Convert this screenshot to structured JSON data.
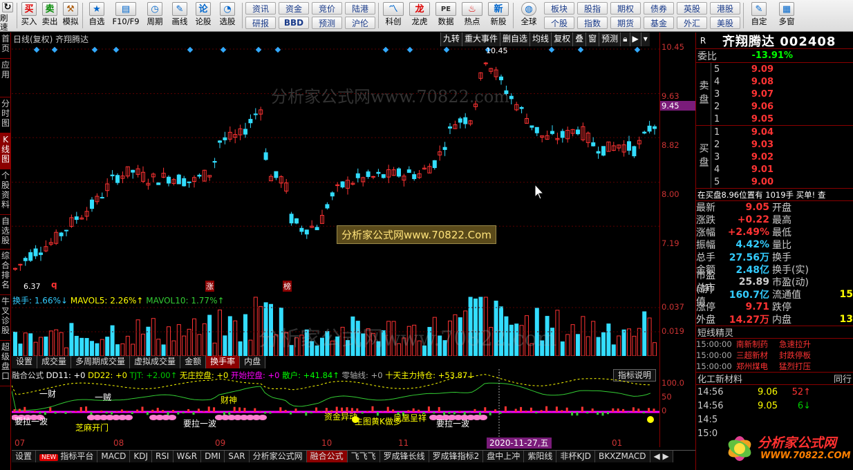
{
  "toolbar": {
    "buttons": [
      {
        "label": "刷速",
        "icon": "refresh-icon"
      },
      {
        "label": "买入",
        "icon": "买"
      },
      {
        "label": "卖出",
        "icon": "卖"
      },
      {
        "label": "模拟",
        "icon": "hammer-icon"
      },
      {
        "label": "自选",
        "icon": "star-icon"
      },
      {
        "label": "F10/F9",
        "icon": "f10-icon"
      },
      {
        "label": "周期",
        "icon": "clock-icon"
      },
      {
        "label": "画线",
        "icon": "pencil-icon"
      },
      {
        "label": "论股",
        "icon": "论"
      },
      {
        "label": "选股",
        "icon": "chart-icon"
      }
    ],
    "pairs": [
      [
        "资讯",
        "研报"
      ],
      [
        "资金",
        "BBD"
      ],
      [
        "竞价",
        "预测"
      ],
      [
        "陆港",
        "沪伦"
      ]
    ],
    "buttons2": [
      {
        "label": "科创",
        "icon": "科"
      },
      {
        "label": "龙虎",
        "icon": "dragon-icon"
      },
      {
        "label": "数据",
        "icon": "PE"
      },
      {
        "label": "热点",
        "icon": "hot-icon"
      },
      {
        "label": "新股",
        "icon": "new-icon"
      },
      {
        "label": "全球",
        "icon": "globe-icon"
      }
    ],
    "pairs2": [
      [
        "板块",
        "个股"
      ],
      [
        "股指",
        "指数"
      ],
      [
        "期权",
        "期货"
      ],
      [
        "债券",
        "基金"
      ],
      [
        "英股",
        "外汇"
      ],
      [
        "港股",
        "美股"
      ]
    ],
    "buttons3": [
      {
        "label": "自定",
        "icon": "custom-icon"
      },
      {
        "label": "多窗",
        "icon": "window-icon"
      }
    ]
  },
  "leftnav": [
    "首页",
    "应用",
    "分时图",
    "K线图",
    "个股资料",
    "自选股",
    "综合排名",
    "牛叉诊股",
    "超级盘口"
  ],
  "chart": {
    "title": "日线(复权) 齐翔腾达",
    "tabs": [
      "九转",
      "重大事件",
      "删自选",
      "均线",
      "复权",
      "叠",
      "窗",
      "预测"
    ],
    "price_labels": [
      "10.45",
      "9.63",
      "8.82",
      "8.00",
      "7.19"
    ],
    "current_price_tag": "9.45",
    "low_label": "6.37",
    "high_label": "10.45",
    "marker_labels": [
      "q",
      "涨",
      "榜"
    ],
    "watermark": "分析家公式网www.70822.com",
    "banner": "分析家公式网www.70822.Com"
  },
  "volume": {
    "label_turnover": "换手: 1.66%↓",
    "label_mavol5": "MAVOL5: 2.26%↑",
    "label_mavol10": "MAVOL10: 1.77%↑",
    "axis": [
      "0.037",
      "0.019"
    ],
    "tabs": [
      "设置",
      "成交量",
      "多周期成交量",
      "虚拟成交量",
      "金额",
      "换手率",
      "内盘"
    ],
    "active_tab": "换手率"
  },
  "indicator": {
    "label_parts": [
      {
        "t": "融合公式 ",
        "c": "#ddd"
      },
      {
        "t": "DD11: +0 ",
        "c": "#fff"
      },
      {
        "t": "DD22: +0 ",
        "c": "#ff0"
      },
      {
        "t": "TJT: +2.00↑ ",
        "c": "#0c0"
      },
      {
        "t": "无庄控盘: +0 ",
        "c": "#ff0"
      },
      {
        "t": "开始控盘: +0 ",
        "c": "#f0f"
      },
      {
        "t": "散户: +41.84↑ ",
        "c": "#0f0"
      },
      {
        "t": "零轴线: +0 ",
        "c": "#aaa"
      },
      {
        "t": "十天主力持仓: +53.87↓",
        "c": "#ff0"
      }
    ],
    "explain": "指标说明",
    "axis": [
      "100.0",
      "50",
      "0"
    ],
    "texts": [
      "要拉一波",
      "芝麻开门",
      "要拉一波",
      "资金异动",
      "主图黄K做多",
      "凤凰呈祥",
      "要拉一波",
      "一财",
      "一贼",
      "财神"
    ]
  },
  "timeaxis": {
    "labels": [
      "07",
      "08",
      "09",
      "10",
      "11",
      "01"
    ],
    "flag": "2020-11-27,五"
  },
  "bottom_tabs": [
    "设置",
    "指标平台",
    "MACD",
    "KDJ",
    "RSI",
    "W&R",
    "DMI",
    "SAR",
    "分析家公式网",
    "融合公式",
    "飞飞飞",
    "罗成锋长线",
    "罗成锋指标2",
    "盘中上冲",
    "紫阳线",
    "非杯KJD",
    "BKXZMACD"
  ],
  "bottom_active": "融合公式",
  "quote": {
    "r": "R",
    "name": "齐翔腾达 002408",
    "weibi_label": "委比",
    "weibi": "-13.91%",
    "sell_label": "卖盘",
    "sell": [
      {
        "lv": "5",
        "p": "9.09",
        "v": ""
      },
      {
        "lv": "4",
        "p": "9.08",
        "v": ""
      },
      {
        "lv": "3",
        "p": "9.07",
        "v": ""
      },
      {
        "lv": "2",
        "p": "9.06",
        "v": ""
      },
      {
        "lv": "1",
        "p": "9.05",
        "v": ""
      }
    ],
    "buy_label": "买盘",
    "buy": [
      {
        "lv": "1",
        "p": "9.04",
        "v": ""
      },
      {
        "lv": "2",
        "p": "9.03",
        "v": ""
      },
      {
        "lv": "3",
        "p": "9.02",
        "v": ""
      },
      {
        "lv": "4",
        "p": "9.01",
        "v": ""
      },
      {
        "lv": "5",
        "p": "9.00",
        "v": ""
      }
    ],
    "notice": "在买盘8.96位置有  1019手 买单!  查",
    "stats": [
      {
        "k": "最新",
        "v": "9.05",
        "c": "#f33",
        "k2": "开盘",
        "v2": ""
      },
      {
        "k": "涨跌",
        "v": "+0.22",
        "c": "#f33",
        "k2": "最高",
        "v2": ""
      },
      {
        "k": "涨幅",
        "v": "+2.49%",
        "c": "#f33",
        "k2": "最低",
        "v2": ""
      },
      {
        "k": "振幅",
        "v": "4.42%",
        "c": "#3cf",
        "k2": "量比",
        "v2": ""
      },
      {
        "k": "总手",
        "v": "27.56万",
        "c": "#3cf",
        "k2": "换手",
        "v2": ""
      },
      {
        "k": "金额",
        "v": "2.48亿",
        "c": "#3cf",
        "k2": "换手(实)",
        "v2": ""
      },
      {
        "k": "市盈(静)",
        "v": "25.89",
        "c": "#ccc",
        "k2": "市盈(动)",
        "v2": ""
      },
      {
        "k": "总市值",
        "v": "160.7亿",
        "c": "#3cf",
        "k2": "流通值",
        "v2": "15"
      },
      {
        "k": "涨停",
        "v": "9.71",
        "c": "#f33",
        "k2": "跌停",
        "v2": ""
      },
      {
        "k": "外盘",
        "v": "14.27万",
        "c": "#f33",
        "k2": "内盘",
        "v2": "13"
      }
    ],
    "news_header": "短线精灵",
    "news": [
      {
        "t": "15:00:00",
        "n": "南新制药",
        "e": "急速拉升"
      },
      {
        "t": "15:00:00",
        "n": "三超新材",
        "e": "封跌停板"
      },
      {
        "t": "15:00:00",
        "n": "郑州煤电",
        "e": "猛烈打压"
      }
    ],
    "ticks_header": "化工新材料",
    "ticks_header2": "同行",
    "ticks": [
      {
        "t": "14:56",
        "p": "9.06",
        "v": "52↑"
      },
      {
        "t": "14:56",
        "p": "9.05",
        "v": "6↓"
      },
      {
        "t": "14:5",
        "p": "",
        "v": ""
      },
      {
        "t": "15:0",
        "p": "",
        "v": ""
      }
    ]
  },
  "logo": {
    "text1": "分析家公式网",
    "text2": "WWW.70822.COM"
  },
  "colors": {
    "up": "#ff3333",
    "down": "#33ddff",
    "bg": "#000000",
    "frame": "#8b0000"
  }
}
